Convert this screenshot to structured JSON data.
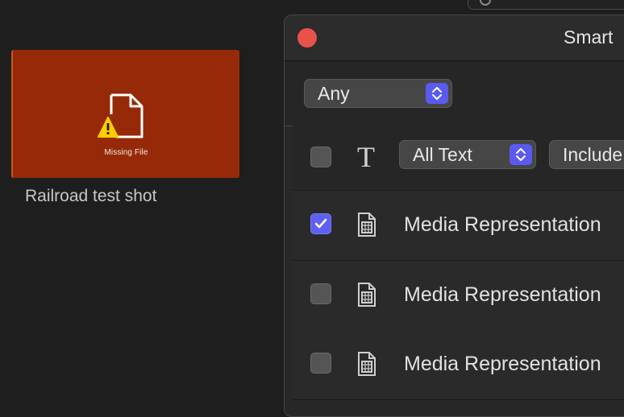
{
  "browser": {
    "clip": {
      "status_label": "Missing File",
      "name": "Railroad test shot"
    }
  },
  "panel": {
    "title": "Smart",
    "match_popup": "Any",
    "text_rule": {
      "field_popup": "All Text",
      "operator_popup": "Include"
    },
    "rules": [
      {
        "label": "Media Representation",
        "checked": true
      },
      {
        "label": "Media Representation",
        "checked": false
      },
      {
        "label": "Media Representation",
        "checked": false
      }
    ]
  },
  "colors": {
    "accent": "#5f5ff2",
    "clip_missing": "#962a08",
    "close_button": "#e9524a",
    "warning": "#ffcc00"
  }
}
